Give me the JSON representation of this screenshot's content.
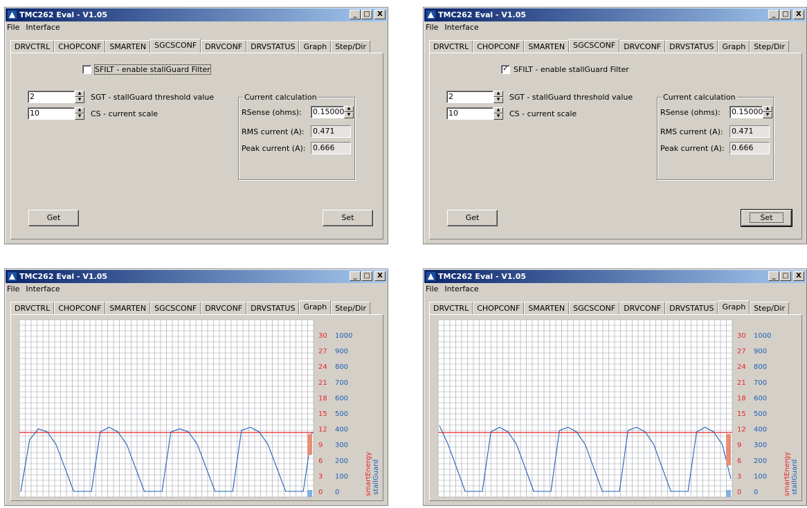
{
  "app": {
    "title": "TMC262 Eval - V1.05",
    "title_buttons": [
      "_",
      "□",
      "X"
    ],
    "menu": [
      "File",
      "Interface"
    ],
    "tabs": [
      "DRVCTRL",
      "CHOPCONF",
      "SMARTEN",
      "SGCSCONF",
      "DRVCONF",
      "DRVSTATUS",
      "Graph",
      "Step/Dir"
    ]
  },
  "sgcsconf": {
    "sfilt_label": "SFILT - enable stallGuard Filter",
    "sgt_value": "2",
    "sgt_label": "SGT - stallGuard threshold value",
    "cs_value": "10",
    "cs_label": "CS - current scale",
    "group_title": "Current calculation",
    "rsense_label": "RSense (ohms):",
    "rsense_value": "0.15000",
    "rms_label": "RMS current (A):",
    "rms_value": "0.471",
    "peak_label": "Peak current (A):",
    "peak_value": "0.666",
    "get_label": "Get",
    "set_label": "Set"
  },
  "windows": [
    {
      "active_tab": "SGCSCONF",
      "sfilt_checked": false,
      "sfilt_mark": ""
    },
    {
      "active_tab": "SGCSCONF",
      "sfilt_checked": true,
      "sfilt_mark": "✓"
    },
    {
      "active_tab": "Graph"
    },
    {
      "active_tab": "Graph"
    }
  ],
  "graph": {
    "smart_energy_label": "smartEnergy",
    "stallguard_label": "stallGuard",
    "colors": {
      "smart_energy": "#e8262a",
      "stallguard": "#1f5fb5",
      "grid": "#9aa0a8",
      "bar": "#e88e77",
      "sg_bar": "#7fb2e0"
    },
    "chart_data": [
      {
        "type": "line",
        "y_se_ticks": [
          "30",
          "27",
          "24",
          "21",
          "18",
          "15",
          "12",
          "9",
          "6",
          "3",
          "0"
        ],
        "y_sg_ticks": [
          "1000",
          "900",
          "800",
          "700",
          "600",
          "500",
          "400",
          "300",
          "200",
          "100",
          "0"
        ],
        "ylim_sg": [
          0,
          1000
        ],
        "series": [
          {
            "name": "smartEnergy",
            "values": [
              11.3,
              11.3
            ]
          },
          {
            "name": "stallGuard",
            "values": [
              0,
              330,
              400,
              380,
              300,
              150,
              0,
              0,
              0,
              380,
              410,
              380,
              300,
              150,
              0,
              0,
              0,
              380,
              400,
              380,
              300,
              150,
              0,
              0,
              0,
              390,
              410,
              380,
              300,
              150,
              0,
              0,
              0,
              380
            ]
          }
        ],
        "current_se_bar": [
          7,
          11
        ],
        "current_sg": 10
      },
      {
        "type": "line",
        "y_se_ticks": [
          "30",
          "27",
          "24",
          "21",
          "18",
          "15",
          "12",
          "9",
          "6",
          "3",
          "0"
        ],
        "y_sg_ticks": [
          "1000",
          "900",
          "800",
          "700",
          "600",
          "500",
          "400",
          "300",
          "200",
          "100",
          "0"
        ],
        "ylim_sg": [
          0,
          1000
        ],
        "series": [
          {
            "name": "smartEnergy",
            "values": [
              11.3,
              11.3
            ]
          },
          {
            "name": "stallGuard",
            "values": [
              420,
              300,
              150,
              0,
              0,
              0,
              380,
              410,
              380,
              300,
              150,
              0,
              0,
              0,
              390,
              410,
              380,
              300,
              150,
              0,
              0,
              0,
              390,
              410,
              380,
              300,
              150,
              0,
              0,
              0,
              380,
              410,
              380,
              300,
              80
            ]
          }
        ],
        "current_se_bar": [
          5,
          11
        ],
        "current_sg": 10
      }
    ]
  }
}
